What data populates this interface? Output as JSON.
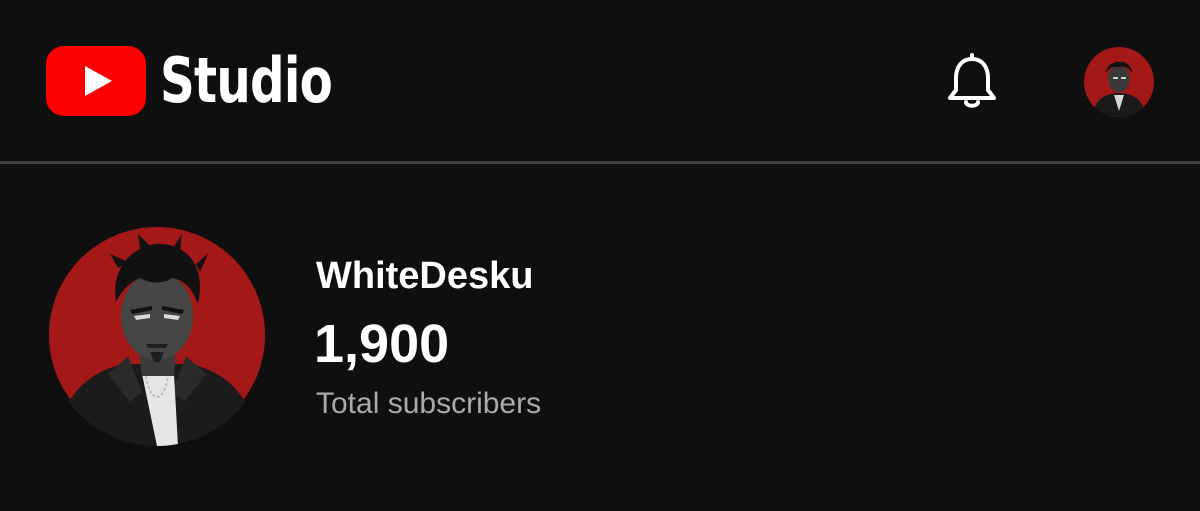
{
  "header": {
    "logo_text": "Studio",
    "logo_icon": "youtube-play-icon",
    "notifications_icon": "bell-icon",
    "account_icon": "avatar"
  },
  "channel": {
    "name": "WhiteDesku",
    "subscriber_count": "1,900",
    "subscriber_label": "Total subscribers"
  },
  "colors": {
    "background": "#0f0f0f",
    "brand_red": "#ff0000",
    "divider": "#3d3d3d",
    "secondary_text": "#aaaaaa",
    "avatar_red": "#a51818"
  }
}
